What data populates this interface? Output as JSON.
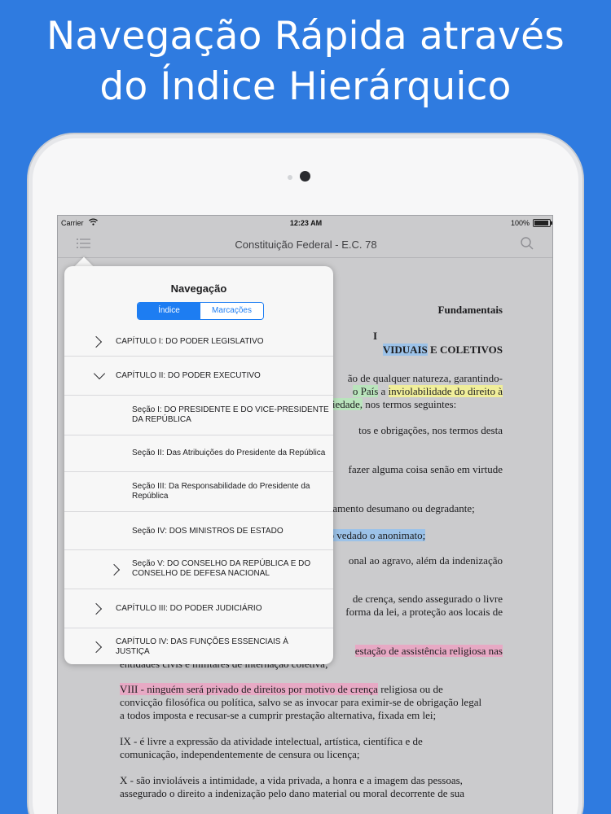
{
  "headline": {
    "line1": "Navegação Rápida através",
    "line2": "do Índice Hierárquico"
  },
  "statusbar": {
    "carrier": "Carrier",
    "time": "12:23 AM",
    "battery": "100%"
  },
  "navbar": {
    "title": "Constituição Federal - E.C. 78"
  },
  "popover": {
    "title": "Navegação",
    "tabs": [
      {
        "label": "Índice",
        "active": true
      },
      {
        "label": "Marcações",
        "active": false
      }
    ],
    "items": [
      {
        "label": "CAPÍTULO I: DO PODER LEGISLATIVO",
        "level": 0,
        "expanded": false
      },
      {
        "label": "CAPÍTULO II: DO PODER EXECUTIVO",
        "level": 0,
        "expanded": true
      },
      {
        "label": "Seção I: DO PRESIDENTE E DO VICE-PRESIDENTE DA REPÚBLICA",
        "level": 1
      },
      {
        "label": "Seção II: Das Atribuições do Presidente da República",
        "level": 1
      },
      {
        "label": "Seção III: Da Responsabilidade do Presidente da República",
        "level": 1
      },
      {
        "label": "Seção IV: DOS MINISTROS DE ESTADO",
        "level": 1
      },
      {
        "label": "Seção V: DO CONSELHO DA REPÚBLICA E DO CONSELHO DE DEFESA NACIONAL",
        "level": 1,
        "expandable": true
      },
      {
        "label": "CAPÍTULO III: DO PODER JUDICIÁRIO",
        "level": 0,
        "expanded": false
      },
      {
        "label": "CAPÍTULO IV: DAS FUNÇÕES ESSENCIAIS À JUSTIÇA",
        "level": 0,
        "expanded": false
      }
    ]
  },
  "document": {
    "heading1": "Fundamentais",
    "heading2a": "I",
    "heading2b_hl": "VIDUAIS",
    "heading2b_rest": " E COLETIVOS",
    "p1_a": "ão de qualquer natureza, garantindo-",
    "p1_b_hl1": "o País",
    "p1_b_mid": " a ",
    "p1_b_hl2": "inviolabilidade do direito à",
    "p1_c_hl": "priedade,",
    "p1_c_rest": " nos termos seguintes:",
    "p2": "tos e obrigações, nos termos desta",
    "p3": "fazer alguma coisa senão em virtude",
    "p4": "atamento desumano ou degradante;",
    "p5_hl": "do vedado o anonimato;",
    "p6": "onal ao agravo, além da indenização",
    "p7_a": "de crença, sendo assegurado o livre",
    "p7_b": "forma da lei, a proteção aos locais de",
    "p8_hl": "estação de assistência religiosa nas",
    "p8_b": "entidades civis e militares de internação coletiva;",
    "p9_hl": "VIII - ninguém será privado de direitos por motivo de crença",
    "p9_a": " religiosa ou de",
    "p9_b": "convicção filosófica ou política, salvo se as invocar para eximir-se de obrigação legal",
    "p9_c": "a todos imposta e recusar-se a cumprir prestação alternativa, fixada em lei;",
    "p10_a": "IX - é livre a expressão da atividade intelectual, artística, científica e de",
    "p10_b": "comunicação, independentemente de censura ou licença;",
    "p11_a": "X - são invioláveis a intimidade, a vida privada, a honra e a imagem das pessoas,",
    "p11_b": "assegurado o direito a indenização pelo dano material ou moral decorrente de sua"
  }
}
